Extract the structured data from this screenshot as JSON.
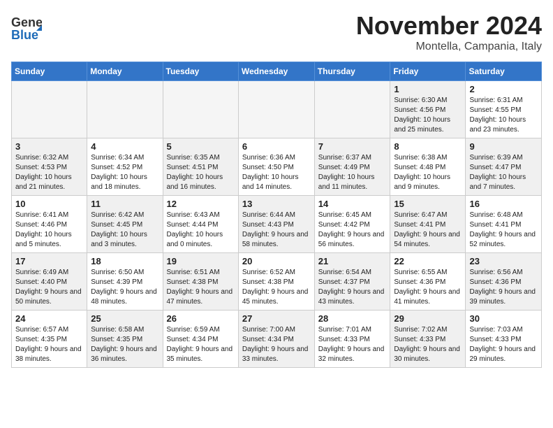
{
  "header": {
    "logo_general": "General",
    "logo_blue": "Blue",
    "month": "November 2024",
    "location": "Montella, Campania, Italy"
  },
  "weekdays": [
    "Sunday",
    "Monday",
    "Tuesday",
    "Wednesday",
    "Thursday",
    "Friday",
    "Saturday"
  ],
  "weeks": [
    [
      {
        "day": "",
        "info": "",
        "empty": true
      },
      {
        "day": "",
        "info": "",
        "empty": true
      },
      {
        "day": "",
        "info": "",
        "empty": true
      },
      {
        "day": "",
        "info": "",
        "empty": true
      },
      {
        "day": "",
        "info": "",
        "empty": true
      },
      {
        "day": "1",
        "info": "Sunrise: 6:30 AM\nSunset: 4:56 PM\nDaylight: 10 hours and 25 minutes.",
        "shaded": true
      },
      {
        "day": "2",
        "info": "Sunrise: 6:31 AM\nSunset: 4:55 PM\nDaylight: 10 hours and 23 minutes."
      }
    ],
    [
      {
        "day": "3",
        "info": "Sunrise: 6:32 AM\nSunset: 4:53 PM\nDaylight: 10 hours and 21 minutes.",
        "shaded": true
      },
      {
        "day": "4",
        "info": "Sunrise: 6:34 AM\nSunset: 4:52 PM\nDaylight: 10 hours and 18 minutes."
      },
      {
        "day": "5",
        "info": "Sunrise: 6:35 AM\nSunset: 4:51 PM\nDaylight: 10 hours and 16 minutes.",
        "shaded": true
      },
      {
        "day": "6",
        "info": "Sunrise: 6:36 AM\nSunset: 4:50 PM\nDaylight: 10 hours and 14 minutes."
      },
      {
        "day": "7",
        "info": "Sunrise: 6:37 AM\nSunset: 4:49 PM\nDaylight: 10 hours and 11 minutes.",
        "shaded": true
      },
      {
        "day": "8",
        "info": "Sunrise: 6:38 AM\nSunset: 4:48 PM\nDaylight: 10 hours and 9 minutes."
      },
      {
        "day": "9",
        "info": "Sunrise: 6:39 AM\nSunset: 4:47 PM\nDaylight: 10 hours and 7 minutes.",
        "shaded": true
      }
    ],
    [
      {
        "day": "10",
        "info": "Sunrise: 6:41 AM\nSunset: 4:46 PM\nDaylight: 10 hours and 5 minutes."
      },
      {
        "day": "11",
        "info": "Sunrise: 6:42 AM\nSunset: 4:45 PM\nDaylight: 10 hours and 3 minutes.",
        "shaded": true
      },
      {
        "day": "12",
        "info": "Sunrise: 6:43 AM\nSunset: 4:44 PM\nDaylight: 10 hours and 0 minutes."
      },
      {
        "day": "13",
        "info": "Sunrise: 6:44 AM\nSunset: 4:43 PM\nDaylight: 9 hours and 58 minutes.",
        "shaded": true
      },
      {
        "day": "14",
        "info": "Sunrise: 6:45 AM\nSunset: 4:42 PM\nDaylight: 9 hours and 56 minutes."
      },
      {
        "day": "15",
        "info": "Sunrise: 6:47 AM\nSunset: 4:41 PM\nDaylight: 9 hours and 54 minutes.",
        "shaded": true
      },
      {
        "day": "16",
        "info": "Sunrise: 6:48 AM\nSunset: 4:41 PM\nDaylight: 9 hours and 52 minutes."
      }
    ],
    [
      {
        "day": "17",
        "info": "Sunrise: 6:49 AM\nSunset: 4:40 PM\nDaylight: 9 hours and 50 minutes.",
        "shaded": true
      },
      {
        "day": "18",
        "info": "Sunrise: 6:50 AM\nSunset: 4:39 PM\nDaylight: 9 hours and 48 minutes."
      },
      {
        "day": "19",
        "info": "Sunrise: 6:51 AM\nSunset: 4:38 PM\nDaylight: 9 hours and 47 minutes.",
        "shaded": true
      },
      {
        "day": "20",
        "info": "Sunrise: 6:52 AM\nSunset: 4:38 PM\nDaylight: 9 hours and 45 minutes."
      },
      {
        "day": "21",
        "info": "Sunrise: 6:54 AM\nSunset: 4:37 PM\nDaylight: 9 hours and 43 minutes.",
        "shaded": true
      },
      {
        "day": "22",
        "info": "Sunrise: 6:55 AM\nSunset: 4:36 PM\nDaylight: 9 hours and 41 minutes."
      },
      {
        "day": "23",
        "info": "Sunrise: 6:56 AM\nSunset: 4:36 PM\nDaylight: 9 hours and 39 minutes.",
        "shaded": true
      }
    ],
    [
      {
        "day": "24",
        "info": "Sunrise: 6:57 AM\nSunset: 4:35 PM\nDaylight: 9 hours and 38 minutes."
      },
      {
        "day": "25",
        "info": "Sunrise: 6:58 AM\nSunset: 4:35 PM\nDaylight: 9 hours and 36 minutes.",
        "shaded": true
      },
      {
        "day": "26",
        "info": "Sunrise: 6:59 AM\nSunset: 4:34 PM\nDaylight: 9 hours and 35 minutes."
      },
      {
        "day": "27",
        "info": "Sunrise: 7:00 AM\nSunset: 4:34 PM\nDaylight: 9 hours and 33 minutes.",
        "shaded": true
      },
      {
        "day": "28",
        "info": "Sunrise: 7:01 AM\nSunset: 4:33 PM\nDaylight: 9 hours and 32 minutes."
      },
      {
        "day": "29",
        "info": "Sunrise: 7:02 AM\nSunset: 4:33 PM\nDaylight: 9 hours and 30 minutes.",
        "shaded": true
      },
      {
        "day": "30",
        "info": "Sunrise: 7:03 AM\nSunset: 4:33 PM\nDaylight: 9 hours and 29 minutes."
      }
    ]
  ]
}
